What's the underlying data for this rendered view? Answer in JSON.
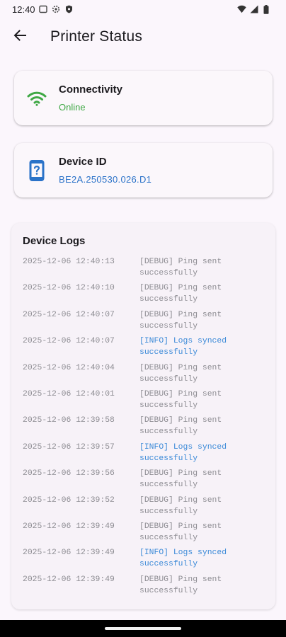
{
  "status_bar": {
    "time": "12:40"
  },
  "app_bar": {
    "title": "Printer Status"
  },
  "connectivity": {
    "title": "Connectivity",
    "status": "Online",
    "status_color": "#3fa845"
  },
  "device": {
    "title": "Device ID",
    "id": "BE2A.250530.026.D1",
    "id_color": "#2a72c8"
  },
  "logs": {
    "title": "Device Logs",
    "entries": [
      {
        "ts": "2025-12-06 12:40:13",
        "msg": "[DEBUG] Ping sent\nsuccessfully",
        "level": "debug"
      },
      {
        "ts": "2025-12-06 12:40:10",
        "msg": "[DEBUG] Ping sent\nsuccessfully",
        "level": "debug"
      },
      {
        "ts": "2025-12-06 12:40:07",
        "msg": "[DEBUG] Ping sent\nsuccessfully",
        "level": "debug"
      },
      {
        "ts": "2025-12-06 12:40:07",
        "msg": "[INFO] Logs synced\nsuccessfully",
        "level": "info"
      },
      {
        "ts": "2025-12-06 12:40:04",
        "msg": "[DEBUG] Ping sent\nsuccessfully",
        "level": "debug"
      },
      {
        "ts": "2025-12-06 12:40:01",
        "msg": "[DEBUG] Ping sent\nsuccessfully",
        "level": "debug"
      },
      {
        "ts": "2025-12-06 12:39:58",
        "msg": "[DEBUG] Ping sent\nsuccessfully",
        "level": "debug"
      },
      {
        "ts": "2025-12-06 12:39:57",
        "msg": "[INFO] Logs synced\nsuccessfully",
        "level": "info"
      },
      {
        "ts": "2025-12-06 12:39:56",
        "msg": "[DEBUG] Ping sent\nsuccessfully",
        "level": "debug"
      },
      {
        "ts": "2025-12-06 12:39:52",
        "msg": "[DEBUG] Ping sent\nsuccessfully",
        "level": "debug"
      },
      {
        "ts": "2025-12-06 12:39:49",
        "msg": "[DEBUG] Ping sent\nsuccessfully",
        "level": "debug"
      },
      {
        "ts": "2025-12-06 12:39:49",
        "msg": "[INFO] Logs synced\nsuccessfully",
        "level": "info"
      },
      {
        "ts": "2025-12-06 12:39:49",
        "msg": "[DEBUG] Ping sent\nsuccessfully",
        "level": "debug"
      }
    ]
  }
}
